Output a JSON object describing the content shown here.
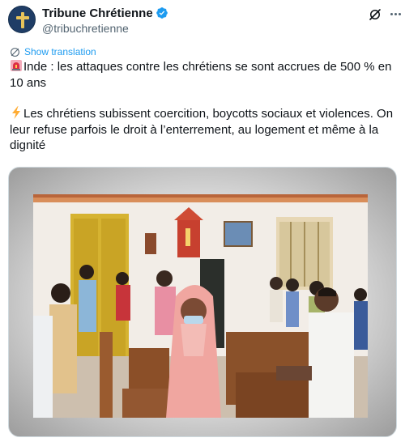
{
  "account": {
    "display_name": "Tribune Chrétienne",
    "handle": "@tribuchretienne",
    "verified": true,
    "avatar_icon": "cross-icon"
  },
  "actions": {
    "grok_icon": "grok-icon",
    "more_icon": "more-dots-icon"
  },
  "translate": {
    "label": "Show translation",
    "icon": "translate-icon"
  },
  "tweet": {
    "paragraphs": [
      {
        "emoji": "siren-icon",
        "text": "Inde : les attaques contre les chrétiens se sont accrues de 500 % en 10 ans"
      },
      {
        "emoji": "lightning-icon",
        "text": "Les chrétiens subissent coercition, boycotts sociaux et violences. On leur refuse parfois le droit à l’enterrement, au logement et même à la dignité"
      }
    ]
  },
  "media": {
    "type": "photo",
    "icon": "church-photo"
  },
  "colors": {
    "accent": "#1d9bf0",
    "text": "#0f1419",
    "secondary": "#536471"
  }
}
